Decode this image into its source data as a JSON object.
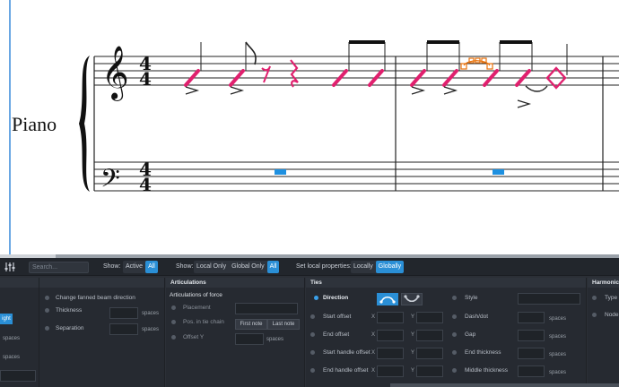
{
  "score": {
    "instrument_name": "Piano",
    "colors": {
      "notes": "#e0206e",
      "selection": "#e8720c",
      "rests": "#1e90e0",
      "ink": "#111111"
    }
  },
  "toolbar": {
    "search_placeholder": "Search...",
    "show1_label": "Show:",
    "show1_options": [
      "Active",
      "All"
    ],
    "show1_selected": "All",
    "show2_label": "Show:",
    "show2_options": [
      "Local Only",
      "Global Only",
      "All"
    ],
    "show2_selected": "All",
    "set_label": "Set local properties:",
    "set_options": [
      "Locally",
      "Globally"
    ],
    "set_selected": "Globally"
  },
  "groups": {
    "left_partial": {
      "button_label": "ight",
      "spaces1": "spaces",
      "spaces2": "spaces"
    },
    "beams": {
      "change_fanned": "Change fanned beam direction",
      "thickness": "Thickness",
      "separation": "Separation",
      "unit1": "spaces",
      "unit2": "spaces"
    },
    "articulations": {
      "title": "Articulations",
      "subtitle": "Articulations of force",
      "placement": "Placement",
      "pos_tie_chain": "Pos. in tie chain",
      "first_note": "First note",
      "last_note": "Last note",
      "offset_y": "Offset Y",
      "unit": "spaces"
    },
    "ties": {
      "title": "Ties",
      "direction": "Direction",
      "start_offset": "Start offset",
      "end_offset": "End offset",
      "start_handle_offset": "Start handle offset",
      "end_handle_offset": "End handle offset",
      "x": "X",
      "y": "Y",
      "style": "Style",
      "dash_dot": "Dash/dot",
      "gap": "Gap",
      "end_thickness": "End thickness",
      "middle_thickness": "Middle thickness",
      "unit": "spaces"
    },
    "harmonics": {
      "title": "Harmonics",
      "type": "Type",
      "node": "Node"
    }
  }
}
